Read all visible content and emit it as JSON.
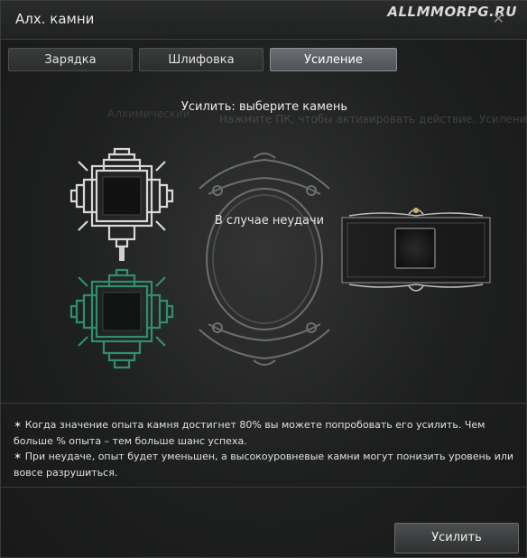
{
  "window": {
    "title": "Алх. камни",
    "watermark": "ALLMMORPG.RU",
    "close_symbol": "✕"
  },
  "tabs": [
    {
      "label": "Зарядка",
      "active": false
    },
    {
      "label": "Шлифовка",
      "active": false
    },
    {
      "label": "Усиление",
      "active": true
    }
  ],
  "main": {
    "instruction": "Усилить: выберите камень",
    "failure_label": "В случае неудачи",
    "background_text_1": "Нажмите ПК, чтобы активировать действие. Усиление",
    "background_text_2": "Алхимический"
  },
  "info": {
    "line1": "✶ Когда значение опыта камня достигнет 80% вы можете попробовать его усилить. Чем больше % опыта – тем больше шанс успеха.",
    "line2": "✶ При неудаче, опыт будет уменьшен, а высокоуровневые камни могут понизить уровень или вовсе разрушиться."
  },
  "actions": {
    "enhance_label": "Усилить"
  },
  "colors": {
    "ornament_white": "#d8d8d8",
    "ornament_green": "#2f8f6d",
    "tab_active": "#5b5e62",
    "frame_gray": "#6d6f6e"
  },
  "icons": [
    "close-icon",
    "upper-stone-slot-ornament",
    "lower-stone-slot-ornament",
    "failure-oval-frame",
    "result-slot-frame"
  ]
}
